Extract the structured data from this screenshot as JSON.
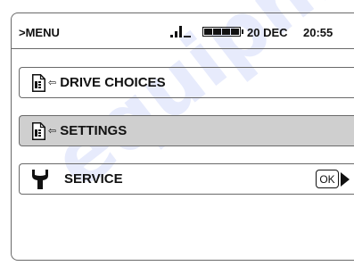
{
  "header": {
    "title": ">MENU",
    "date": "20 DEC",
    "time": "20:55",
    "signal_icon": "signal-strength-icon",
    "battery_icon": "battery-full-icon"
  },
  "menu": {
    "items": [
      {
        "label": "DRIVE CHOICES",
        "icon": "document-icon",
        "selected": false
      },
      {
        "label": "SETTINGS",
        "icon": "document-icon",
        "selected": true
      },
      {
        "label": "SERVICE",
        "icon": "wrench-icon",
        "selected": false,
        "confirm": "OK"
      }
    ]
  },
  "colors": {
    "selected_background": "#cfcfcf",
    "border": "#6a6a6a",
    "watermark": "#4664e6"
  },
  "watermark": "equipme"
}
